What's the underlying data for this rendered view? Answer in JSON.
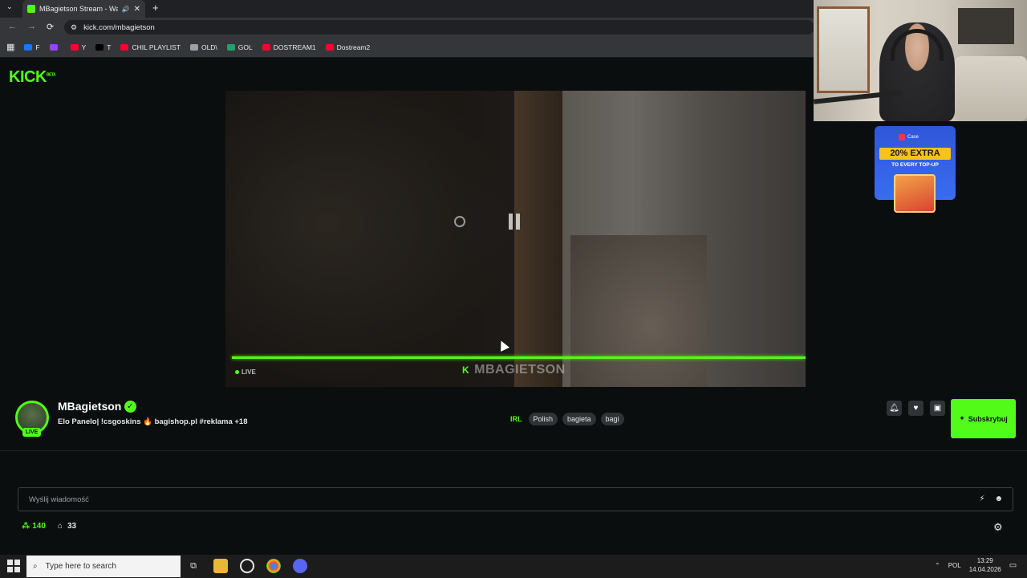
{
  "browser": {
    "tab_title": "MBagietson Stream - Watc",
    "url": "kick.com/mbagietson",
    "bookmarks": [
      {
        "label": "F",
        "color": "#1877f2"
      },
      {
        "label": "",
        "color": "#9146ff"
      },
      {
        "label": "Y",
        "color": "#ff0033"
      },
      {
        "label": "T",
        "color": "#000000"
      },
      {
        "label": "CHIL PLAYLIST",
        "color": "#ff0033"
      },
      {
        "label": "OLD\\",
        "color": "#9aa0a6"
      },
      {
        "label": "GOL",
        "color": "#22a06b"
      },
      {
        "label": "DOSTREAM1",
        "color": "#ff0033"
      },
      {
        "label": "Dostream2",
        "color": "#ff0033"
      }
    ]
  },
  "site": {
    "logo": "KICK",
    "logo_sup": "BETA"
  },
  "player": {
    "live_label": "LIVE",
    "watermark": "MBAGIETSON",
    "progress": 1.0
  },
  "ad": {
    "brand": "Case",
    "headline": "20% EXTRA",
    "subline": "TO EVERY TOP-UP"
  },
  "channel": {
    "name": "MBagietson",
    "live_badge": "LIVE",
    "title": "Elo Panelo| !csgoskins 🔥 bagishop.pl #reklama +18",
    "category": "IRL",
    "tags": [
      "Polish",
      "bagieta",
      "bagi"
    ],
    "subscribe_label": "Subskrybuj",
    "accent_color": "#53fc18"
  },
  "chat": {
    "placeholder": "Wyślij wiadomość",
    "viewers": "140",
    "stat2": "33"
  },
  "taskbar": {
    "search_placeholder": "Type here to search",
    "lang": "POL",
    "time": "13:29",
    "date": "14.04.2026"
  }
}
